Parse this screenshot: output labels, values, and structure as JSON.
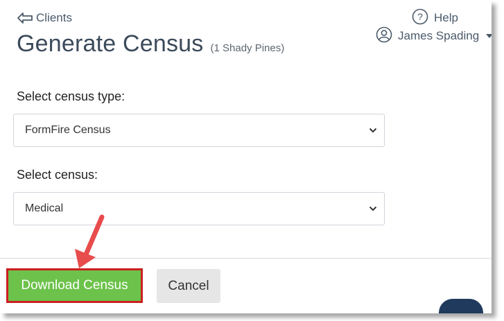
{
  "nav": {
    "back_label": "Clients"
  },
  "header": {
    "title": "Generate Census",
    "subtitle": "(1 Shady Pines)",
    "help_label": "Help",
    "user_name": "James Spading"
  },
  "form": {
    "census_type_label": "Select census type:",
    "census_type_value": "FormFire Census",
    "census_label": "Select census:",
    "census_value": "Medical"
  },
  "actions": {
    "download_label": "Download Census",
    "cancel_label": "Cancel"
  },
  "colors": {
    "primary_green": "#6cc24a",
    "highlight_red": "#cc1f1f",
    "annotation_arrow": "#e84c4c",
    "chat_navy": "#1f3a5c"
  }
}
